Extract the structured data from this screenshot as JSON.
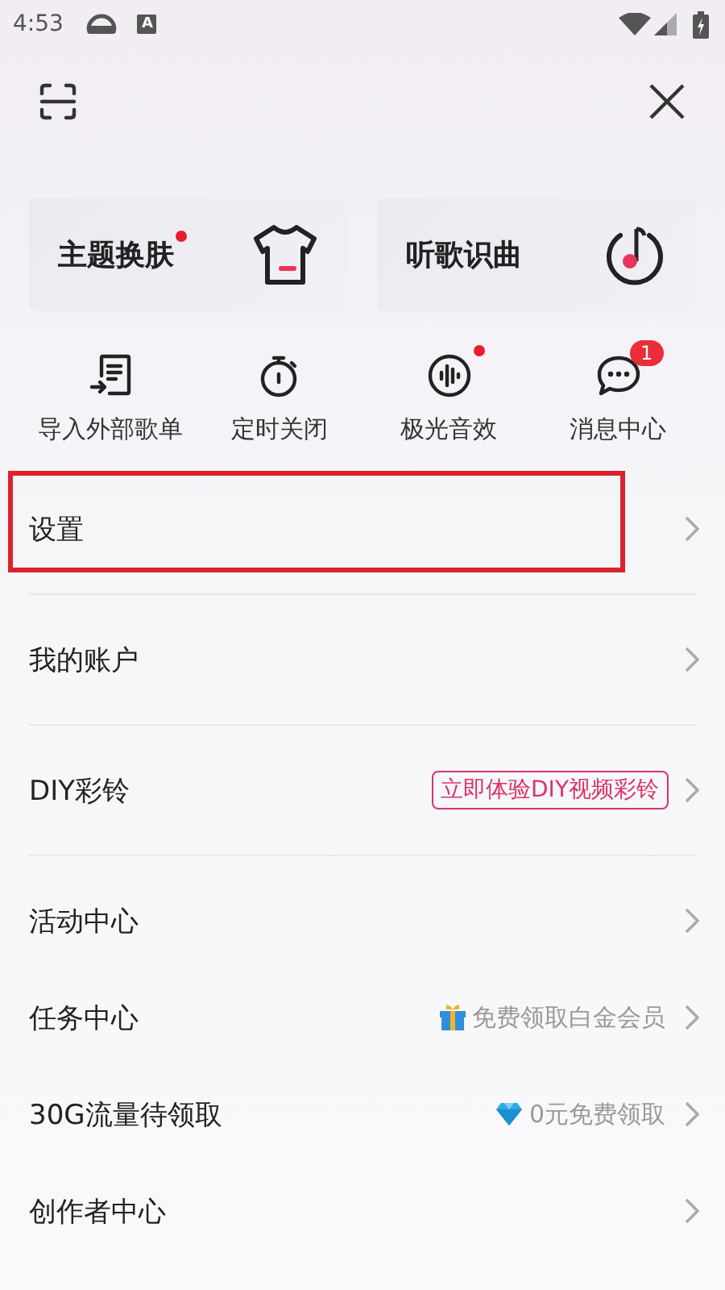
{
  "status_bar": {
    "time": "4:53",
    "notice_letter": "A"
  },
  "cards": [
    {
      "label": "主题换肤",
      "kind": "shirt",
      "dot": true
    },
    {
      "label": "听歌识曲",
      "kind": "music",
      "dot": false
    }
  ],
  "shortcuts": [
    {
      "label": "导入外部歌单",
      "kind": "import",
      "dot": false
    },
    {
      "label": "定时关闭",
      "kind": "timer",
      "dot": false
    },
    {
      "label": "极光音效",
      "kind": "sound",
      "dot": true
    },
    {
      "label": "消息中心",
      "kind": "message",
      "dot": false,
      "badge": "1"
    }
  ],
  "menu_groups": [
    {
      "items": [
        {
          "label": "设置",
          "highlighted": true
        }
      ]
    },
    {
      "items": [
        {
          "label": "我的账户",
          "highlighted": false
        }
      ]
    },
    {
      "items": [
        {
          "label": "DIY彩铃",
          "highlighted": false,
          "extra": {
            "kind": "tag",
            "text": "立即体验DIY视频彩铃"
          }
        }
      ]
    },
    {
      "items": [
        {
          "label": "活动中心",
          "highlighted": false
        },
        {
          "label": "任务中心",
          "highlighted": false,
          "extra": {
            "kind": "gift",
            "text": "免费领取白金会员"
          }
        },
        {
          "label": "30G流量待领取",
          "highlighted": false,
          "extra": {
            "kind": "diamond",
            "text": "0元免费领取"
          }
        },
        {
          "label": "创作者中心",
          "highlighted": false
        }
      ]
    }
  ]
}
